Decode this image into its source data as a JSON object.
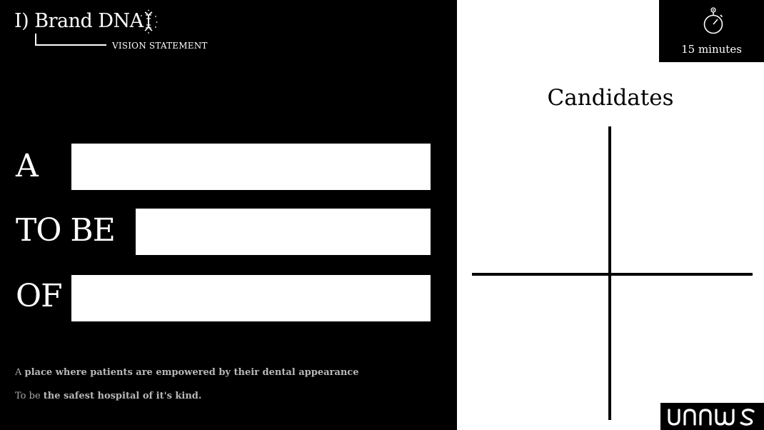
{
  "header": {
    "title": "I) Brand DNA",
    "subtitle": "VISION STATEMENT",
    "icon": "dna-icon"
  },
  "statement_rows": [
    {
      "label": "A",
      "value": ""
    },
    {
      "label": "TO BE",
      "value": ""
    },
    {
      "label": "OF",
      "value": ""
    }
  ],
  "examples": [
    {
      "prefix": "A ",
      "emphasis": "place where patients are empowered by their dental appearance"
    },
    {
      "prefix": "To be ",
      "emphasis": "the safest hospital of it's kind."
    }
  ],
  "timer": {
    "text": "15 minutes",
    "icon": "stopwatch-icon"
  },
  "candidates": {
    "title": "Candidates"
  },
  "brand": {
    "logo_text": "unnws",
    "icon": "brand-logo"
  },
  "colors": {
    "left_background": "#000000",
    "right_background": "#ffffff",
    "blank_field": "#ffffff",
    "example_text": "#a8a8a8"
  }
}
